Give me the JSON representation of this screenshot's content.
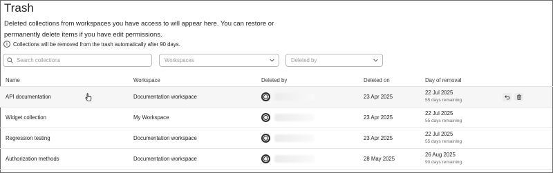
{
  "page": {
    "title": "Trash",
    "description": "Deleted collections from workspaces you have access to will appear here. You can restore or permanently delete items if you have edit permissions.",
    "notice": "Collections will be removed from the trash automatically after 90 days."
  },
  "filters": {
    "search_placeholder": "Search collections",
    "workspaces_placeholder": "Workspaces",
    "deleted_by_placeholder": "Deleted by"
  },
  "table": {
    "headers": {
      "name": "Name",
      "workspace": "Workspace",
      "deleted_by": "Deleted by",
      "deleted_on": "Deleted on",
      "day_of_removal": "Day of removal"
    },
    "rows": [
      {
        "name": "API documentation",
        "workspace": "Documentation workspace",
        "deleted_on": "23 Apr 2025",
        "removal_date": "22 Jul 2025",
        "remaining": "55 days remaining"
      },
      {
        "name": "Widget collection",
        "workspace": "My Workspace",
        "deleted_on": "23 Apr 2025",
        "removal_date": "22 Jul 2025",
        "remaining": "55 days remaining"
      },
      {
        "name": "Regression testing",
        "workspace": "Documentation workspace",
        "deleted_on": "23 Apr 2025",
        "removal_date": "22 Jul 2025",
        "remaining": "55 days remaining"
      },
      {
        "name": "Authorization methods",
        "workspace": "Documentation workspace",
        "deleted_on": "28 May 2025",
        "removal_date": "26 Aug 2025",
        "remaining": "90 days remaining"
      }
    ]
  },
  "icons": {
    "info": "info-icon",
    "search": "search-icon",
    "chevron": "chevron-down-icon",
    "restore": "restore-icon",
    "delete": "trash-icon",
    "avatar": "user-avatar"
  }
}
